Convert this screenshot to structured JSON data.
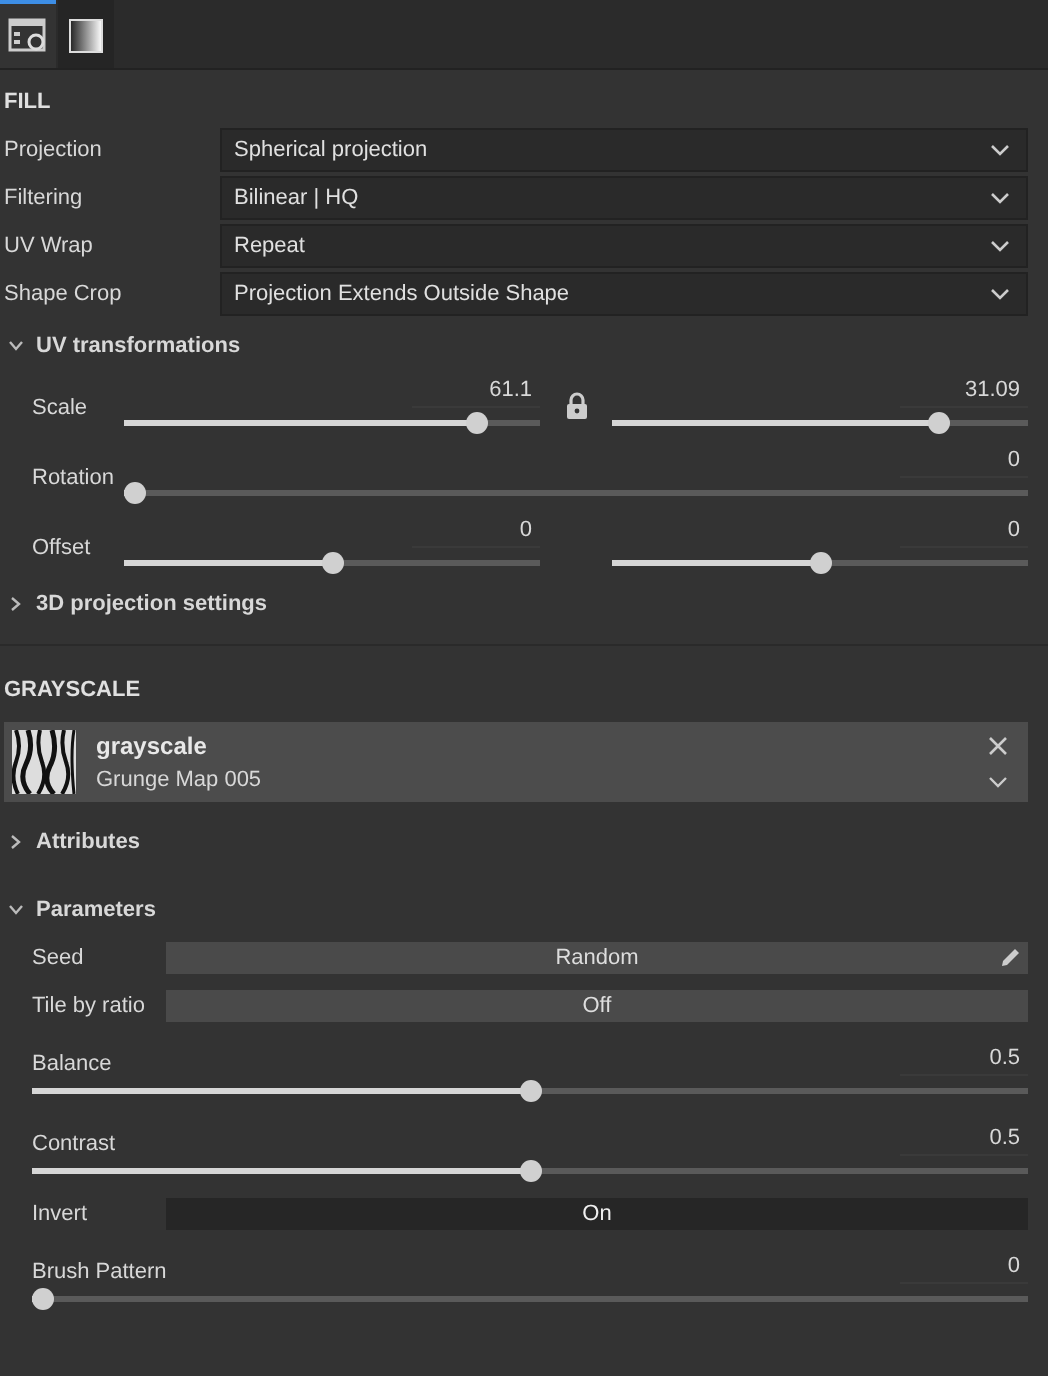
{
  "tabs": [
    {
      "kind": "properties",
      "selected": true
    },
    {
      "kind": "gradient",
      "selected": false
    }
  ],
  "fill": {
    "title": "FILL",
    "fields": [
      {
        "label": "Projection",
        "value": "Spherical projection"
      },
      {
        "label": "Filtering",
        "value": "Bilinear | HQ"
      },
      {
        "label": "UV Wrap",
        "value": "Repeat"
      },
      {
        "label": "Shape Crop",
        "value": "Projection Extends Outside Shape"
      }
    ]
  },
  "uv": {
    "title": "UV transformations",
    "expanded": true,
    "rows": [
      {
        "kind": "pair",
        "label": "Scale",
        "locked": true,
        "sliders": [
          {
            "value": "61.1",
            "level": 0.87
          },
          {
            "value": "31.09",
            "level": 0.8
          }
        ]
      },
      {
        "kind": "single",
        "label": "Rotation",
        "sliders": [
          {
            "value": "0",
            "level": 0
          }
        ]
      },
      {
        "kind": "pair",
        "label": "Offset",
        "locked": false,
        "sliders": [
          {
            "value": "0",
            "level": 0.5
          },
          {
            "value": "0",
            "level": 0.5
          }
        ]
      }
    ]
  },
  "projection3d": {
    "title": "3D projection settings",
    "expanded": false
  },
  "grayscale": {
    "title": "GRAYSCALE",
    "resource": {
      "name": "grayscale",
      "subtitle": "Grunge Map 005"
    },
    "attributes": {
      "title": "Attributes",
      "expanded": false
    },
    "parameters": {
      "title": "Parameters",
      "expanded": true,
      "rows": [
        {
          "kind": "button",
          "label": "Seed",
          "value": "Random",
          "editable": true
        },
        {
          "kind": "toggle",
          "label": "Tile by ratio",
          "value": "Off",
          "on": false
        },
        {
          "kind": "slider",
          "label": "Balance",
          "value": "0.5",
          "level": 0.5
        },
        {
          "kind": "slider",
          "label": "Contrast",
          "value": "0.5",
          "level": 0.5
        },
        {
          "kind": "toggle",
          "label": "Invert",
          "value": "On",
          "on": true
        },
        {
          "kind": "slider",
          "label": "Brush Pattern",
          "value": "0",
          "level": 0
        }
      ]
    }
  }
}
